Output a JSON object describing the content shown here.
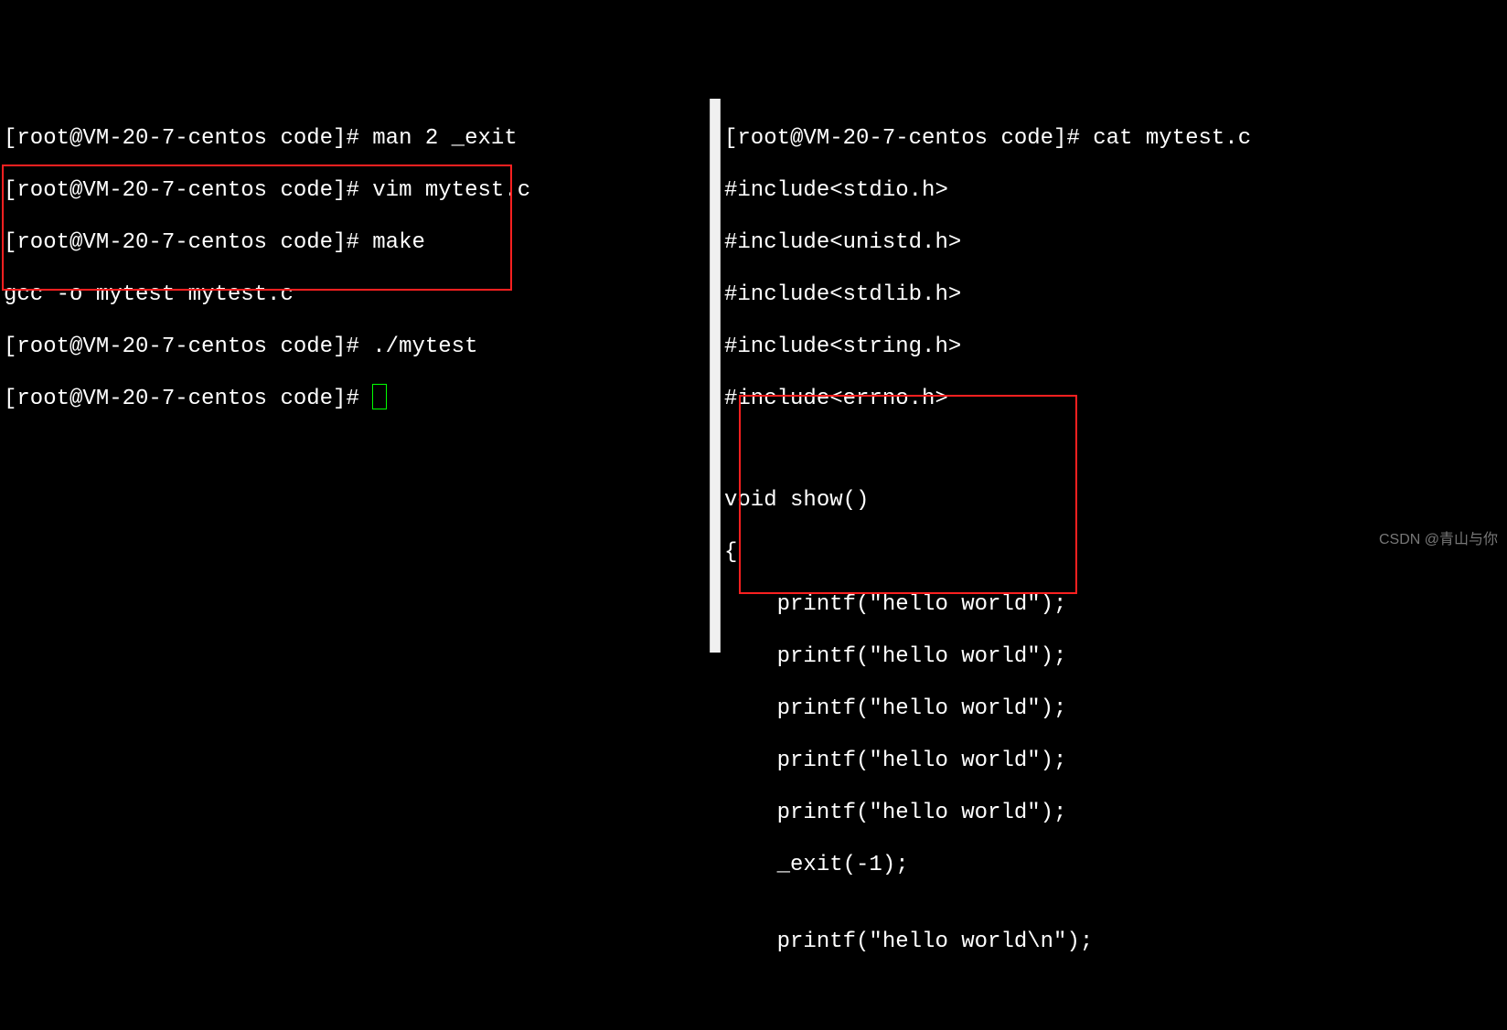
{
  "left": {
    "prompt": "[root@VM-20-7-centos code]# ",
    "lines": [
      "man 2 _exit",
      "vim mytest.c",
      "make"
    ],
    "gcc_line": "gcc -o mytest mytest.c",
    "run_cmd": "./mytest",
    "empty_prompt": true
  },
  "right": {
    "prompt": "[root@VM-20-7-centos code]# ",
    "cmd": "cat mytest.c",
    "code": [
      "#include<stdio.h>",
      "#include<unistd.h>",
      "#include<stdlib.h>",
      "#include<string.h>",
      "#include<errno.h>",
      "",
      "",
      "void show()",
      "{",
      "    printf(\"hello world\");",
      "    printf(\"hello world\");",
      "    printf(\"hello world\");",
      "    printf(\"hello world\");",
      "    printf(\"hello world\");",
      "    _exit(-1);",
      "",
      "    printf(\"hello world\\n\");"
    ]
  },
  "watermark": "CSDN @青山与你"
}
